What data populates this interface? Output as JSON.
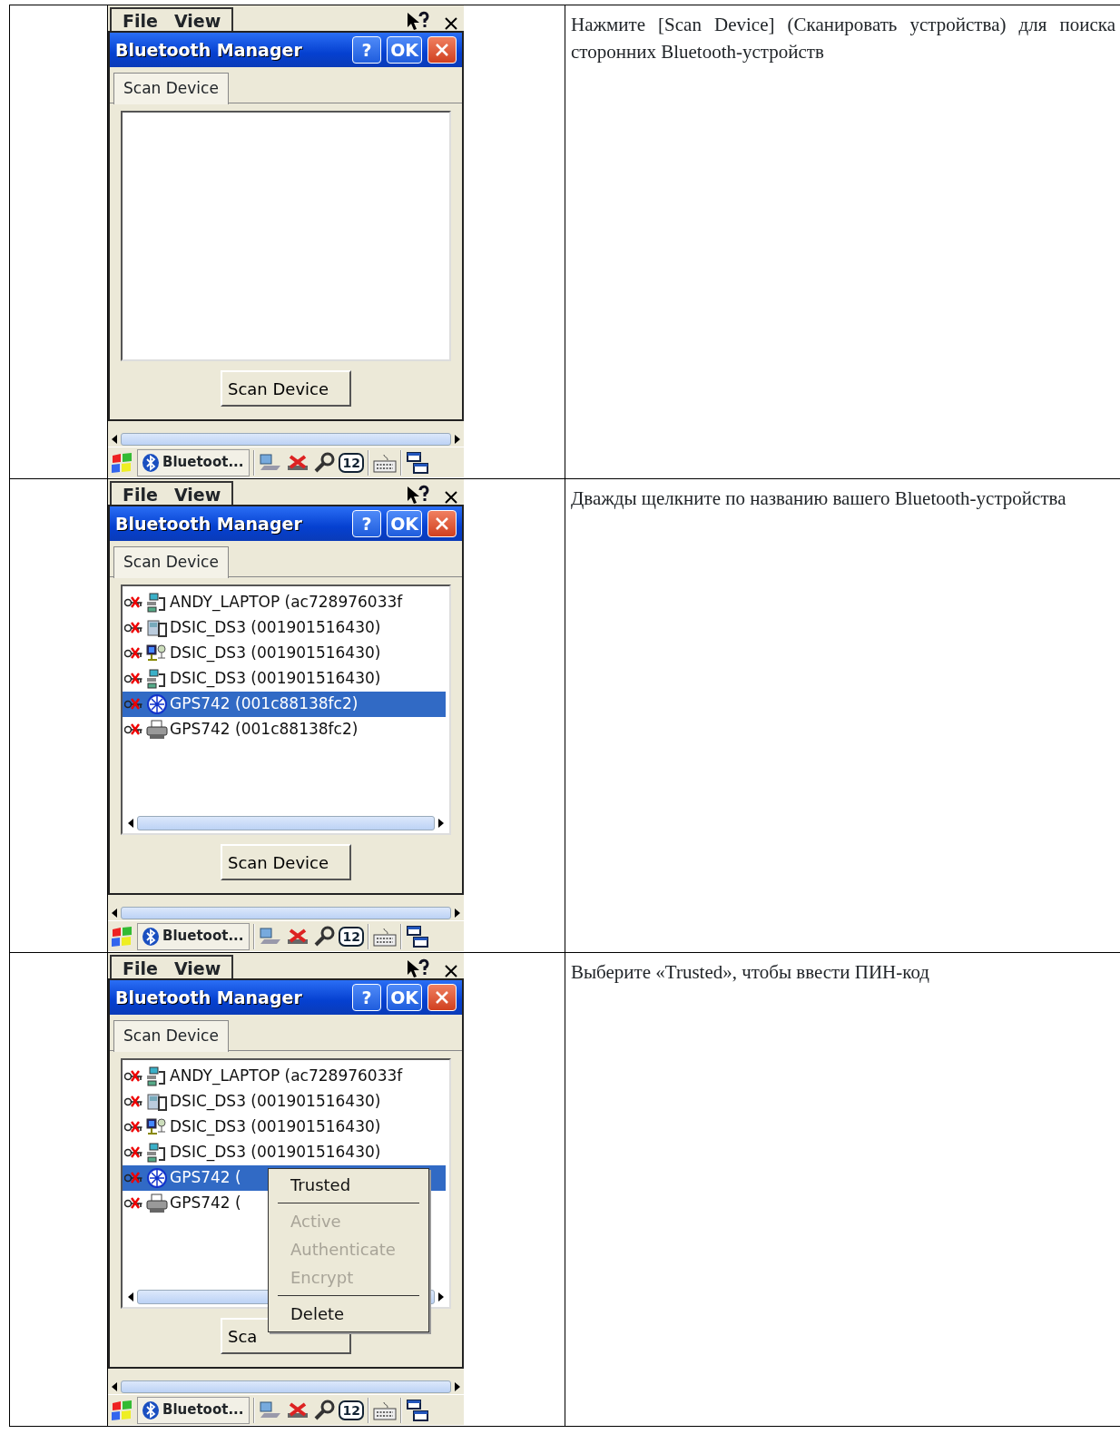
{
  "rows": [
    {
      "screen": {
        "app_menu": [
          "File",
          "View"
        ],
        "title": "Bluetooth Manager",
        "title_buttons": [
          "?",
          "OK"
        ],
        "tab": {
          "label": "Scan Device",
          "selected": true
        },
        "list_scrollbar": false,
        "scan_button": "Scan Device",
        "taskbar": {
          "task": "Bluetoot...",
          "badge": "12"
        }
      },
      "instruction": "Нажмите [Scan Device] (Сканировать устройства) для поиска сторонних Bluetooth-устройств"
    },
    {
      "screen": {
        "app_menu": [
          "File",
          "View"
        ],
        "title": "Bluetooth Manager",
        "title_buttons": [
          "?",
          "OK"
        ],
        "tab": {
          "label": "Scan Device",
          "selected": true
        },
        "devices": [
          {
            "kind": "laptop",
            "name": "ANDY_LAPTOP (ac728976033f",
            "selected": false
          },
          {
            "kind": "server",
            "name": "DSIC_DS3 (001901516430)",
            "selected": false
          },
          {
            "kind": "network",
            "name": "DSIC_DS3 (001901516430)",
            "selected": false
          },
          {
            "kind": "laptop",
            "name": "DSIC_DS3 (001901516430)",
            "selected": false
          },
          {
            "kind": "gps",
            "name": "GPS742 (001c88138fc2)",
            "selected": true
          },
          {
            "kind": "printer",
            "name": "GPS742 (001c88138fc2)",
            "selected": false
          }
        ],
        "list_scrollbar": true,
        "scan_button": "Scan Device",
        "taskbar": {
          "task": "Bluetoot...",
          "badge": "12"
        }
      },
      "instruction": "Дважды щелкните по названию вашего Bluetooth-устройства"
    },
    {
      "screen": {
        "app_menu": [
          "File",
          "View"
        ],
        "title": "Bluetooth Manager",
        "title_buttons": [
          "?",
          "OK"
        ],
        "tab": {
          "label": "Scan Device",
          "selected": true
        },
        "devices": [
          {
            "kind": "laptop",
            "name": "ANDY_LAPTOP (ac728976033f",
            "selected": false
          },
          {
            "kind": "server",
            "name": "DSIC_DS3 (001901516430)",
            "selected": false
          },
          {
            "kind": "network",
            "name": "DSIC_DS3 (001901516430)",
            "selected": false
          },
          {
            "kind": "laptop",
            "name": "DSIC_DS3 (001901516430)",
            "selected": false
          },
          {
            "kind": "gps",
            "name": "GPS742 (",
            "selected": true
          },
          {
            "kind": "printer",
            "name": "GPS742 (",
            "selected": false
          }
        ],
        "list_scrollbar": true,
        "scan_button": "Sca",
        "taskbar": {
          "task": "Bluetoot...",
          "badge": "12"
        },
        "context_menu": [
          {
            "kind": "item",
            "label": "Trusted",
            "disabled": false
          },
          {
            "kind": "separator"
          },
          {
            "kind": "item",
            "label": "Active",
            "disabled": true
          },
          {
            "kind": "item",
            "label": "Authenticate",
            "disabled": true
          },
          {
            "kind": "item",
            "label": "Encrypt",
            "disabled": true
          },
          {
            "kind": "separator"
          },
          {
            "kind": "item",
            "label": "Delete",
            "disabled": false
          }
        ]
      },
      "instruction": "Выберите «Trusted», чтобы ввести ПИН-код"
    }
  ]
}
